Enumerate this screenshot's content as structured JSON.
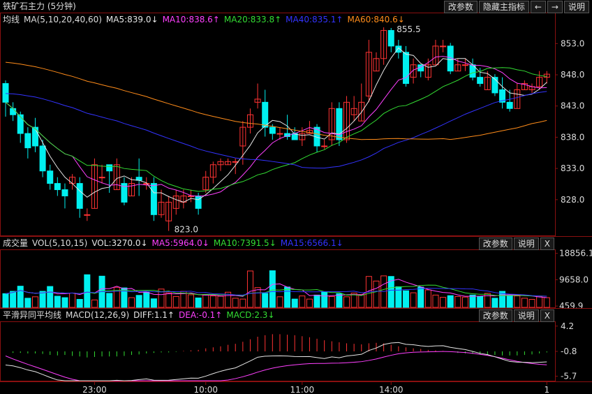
{
  "title": "铁矿石主力 (5分钟)",
  "top_buttons": [
    "改参数",
    "隐藏主指标",
    "←",
    "→",
    "说明"
  ],
  "ma_legend": {
    "label": "均线",
    "params": "MA(5,10,20,40,60)",
    "items": [
      {
        "text": "MA5:839.0↓",
        "color": "#e6e6e6"
      },
      {
        "text": "MA10:838.6↑",
        "color": "#ff40ff"
      },
      {
        "text": "MA20:833.8↑",
        "color": "#33dd33"
      },
      {
        "text": "MA40:835.1↑",
        "color": "#3333ff"
      },
      {
        "text": "MA60:840.6↓",
        "color": "#ff8c1a"
      }
    ]
  },
  "vol_legend": {
    "label": "成交量",
    "params": "VOL(5,10,15)",
    "items": [
      {
        "text": "VOL:3270.0↓",
        "color": "#e6e6e6"
      },
      {
        "text": "MA5:5964.0↓",
        "color": "#ff40ff"
      },
      {
        "text": "MA10:7391.5↓",
        "color": "#33dd33"
      },
      {
        "text": "MA15:6566.1↓",
        "color": "#3333ff"
      }
    ],
    "buttons": [
      "改参数",
      "说明",
      "X"
    ]
  },
  "macd_legend": {
    "label": "平滑异同平均线",
    "params": "MACD(12,26,9)",
    "items": [
      {
        "text": "DIFF:1.1↑",
        "color": "#e6e6e6"
      },
      {
        "text": "DEA:-0.1↑",
        "color": "#ff40ff"
      },
      {
        "text": "MACD:2.3↓",
        "color": "#33dd33"
      }
    ],
    "buttons": [
      "改参数",
      "说明",
      "X"
    ]
  },
  "colors": {
    "up": "#ff3333",
    "down": "#00f0f0",
    "axis": "#8a1010",
    "text": "#dddddd",
    "bg": "#000000"
  },
  "chart_data": [
    {
      "type": "candlestick",
      "title": "铁矿石主力 (5分钟)",
      "ylim": [
        822.5,
        855.5
      ],
      "yticks": [
        828.0,
        833.0,
        838.0,
        843.0,
        848.0,
        853.0
      ],
      "high_label": "855.5",
      "low_label": "823.0",
      "candles": [
        [
          846.6,
          843.6,
          847.1,
          841.3
        ],
        [
          842.6,
          841.6,
          843.6,
          840.6
        ],
        [
          841.6,
          838.6,
          842.1,
          837.1
        ],
        [
          838.6,
          836.3,
          839.6,
          834.6
        ],
        [
          839.6,
          836.6,
          841.1,
          835.6
        ],
        [
          836.6,
          832.6,
          837.6,
          831.6
        ],
        [
          832.6,
          830.6,
          833.6,
          829.6
        ],
        [
          830.6,
          829.6,
          831.6,
          828.6
        ],
        [
          829.6,
          828.6,
          830.6,
          826.6
        ],
        [
          830.6,
          831.6,
          832.1,
          829.6
        ],
        [
          830.6,
          826.6,
          831.6,
          825.1
        ],
        [
          825.6,
          825.6,
          826.6,
          824.6
        ],
        [
          826.6,
          833.6,
          834.6,
          826.6
        ],
        [
          831.6,
          831.6,
          833.6,
          830.6
        ],
        [
          833.6,
          832.6,
          833.6,
          829.1
        ],
        [
          829.6,
          833.6,
          834.6,
          829.6
        ],
        [
          830.6,
          827.6,
          831.6,
          827.1
        ],
        [
          828.6,
          830.6,
          831.6,
          828.6
        ],
        [
          831.6,
          831.1,
          834.6,
          828.6
        ],
        [
          830.6,
          830.6,
          831.6,
          829.6
        ],
        [
          830.6,
          825.6,
          831.6,
          824.6
        ],
        [
          825.6,
          827.6,
          829.6,
          825.1
        ],
        [
          824.6,
          827.6,
          828.6,
          823.0
        ],
        [
          826.6,
          828.6,
          829.6,
          825.6
        ],
        [
          827.6,
          828.6,
          829.6,
          826.6
        ],
        [
          828.6,
          828.6,
          829.6,
          827.6
        ],
        [
          828.6,
          826.6,
          829.1,
          825.6
        ],
        [
          829.6,
          831.6,
          832.6,
          829.1
        ],
        [
          831.6,
          833.6,
          834.1,
          830.6
        ],
        [
          833.6,
          834.1,
          834.6,
          832.6
        ],
        [
          833.6,
          834.1,
          834.6,
          833.6
        ],
        [
          834.1,
          834.1,
          834.6,
          832.1
        ],
        [
          836.6,
          839.6,
          840.6,
          833.6
        ],
        [
          839.6,
          841.6,
          842.6,
          838.6
        ],
        [
          843.6,
          844.1,
          846.6,
          842.6
        ],
        [
          843.6,
          839.6,
          845.6,
          838.1
        ],
        [
          839.6,
          838.6,
          840.1,
          837.6
        ],
        [
          838.6,
          838.6,
          839.6,
          837.6
        ],
        [
          838.6,
          838.1,
          841.6,
          837.6
        ],
        [
          838.6,
          837.6,
          839.6,
          837.6
        ],
        [
          837.6,
          838.6,
          839.6,
          836.6
        ],
        [
          838.6,
          839.1,
          840.6,
          838.6
        ],
        [
          839.6,
          836.6,
          840.1,
          835.6
        ],
        [
          836.6,
          836.6,
          837.6,
          836.1
        ],
        [
          837.6,
          842.6,
          843.6,
          836.6
        ],
        [
          842.6,
          837.6,
          843.6,
          836.6
        ],
        [
          837.6,
          843.6,
          844.6,
          837.1
        ],
        [
          841.6,
          842.6,
          844.6,
          840.6
        ],
        [
          840.6,
          843.6,
          846.6,
          840.6
        ],
        [
          844.6,
          851.6,
          853.6,
          843.6
        ],
        [
          848.6,
          850.6,
          851.6,
          848.6
        ],
        [
          850.6,
          855.1,
          855.6,
          849.6
        ],
        [
          855.1,
          852.6,
          855.5,
          851.6
        ],
        [
          852.6,
          851.6,
          853.6,
          850.6
        ],
        [
          851.6,
          846.6,
          852.6,
          846.1
        ],
        [
          847.6,
          849.6,
          850.6,
          846.6
        ],
        [
          849.6,
          848.6,
          849.6,
          847.6
        ],
        [
          847.6,
          849.6,
          850.6,
          847.1
        ],
        [
          849.6,
          852.6,
          853.6,
          849.6
        ],
        [
          852.6,
          852.6,
          853.6,
          851.6
        ],
        [
          852.6,
          848.6,
          853.1,
          848.1
        ],
        [
          848.6,
          849.6,
          850.6,
          848.6
        ],
        [
          849.6,
          849.6,
          850.6,
          848.6
        ],
        [
          849.6,
          847.6,
          850.6,
          847.1
        ],
        [
          847.6,
          846.6,
          849.1,
          846.1
        ],
        [
          845.6,
          847.6,
          848.6,
          845.6
        ],
        [
          847.6,
          845.1,
          848.1,
          844.6
        ],
        [
          845.6,
          843.6,
          847.6,
          842.6
        ],
        [
          843.6,
          842.6,
          845.6,
          842.1
        ],
        [
          842.6,
          845.6,
          846.6,
          842.6
        ],
        [
          845.6,
          846.6,
          847.1,
          845.6
        ],
        [
          845.6,
          846.1,
          846.6,
          845.1
        ],
        [
          846.1,
          847.6,
          848.6,
          845.6
        ],
        [
          847.6,
          848.1,
          848.6,
          846.6
        ]
      ],
      "x_ticks": [
        {
          "index": 12,
          "label": "23:00"
        },
        {
          "index": 27,
          "label": "10:00"
        },
        {
          "index": 40,
          "label": "11:00"
        },
        {
          "index": 52,
          "label": "14:00"
        },
        {
          "index": 73,
          "label": "1"
        }
      ]
    },
    {
      "type": "bar",
      "title": "VOL(5,10,15)",
      "ylim": [
        0,
        20000
      ],
      "yticks": [
        459.9,
        9658.0,
        18856.1
      ],
      "values": [
        4800,
        5600,
        7400,
        3200,
        3700,
        5600,
        7300,
        3900,
        3400,
        5000,
        2800,
        11400,
        2600,
        10900,
        4900,
        7000,
        6800,
        3400,
        4200,
        5300,
        3000,
        6400,
        5100,
        3800,
        5600,
        4400,
        3300,
        4300,
        4000,
        3900,
        5300,
        3200,
        2900,
        12700,
        6900,
        4900,
        12800,
        3700,
        7100,
        2900,
        4000,
        2900,
        4300,
        5400,
        3800,
        4800,
        3700,
        5000,
        4500,
        10800,
        9200,
        11000,
        10800,
        7200,
        5800,
        5100,
        7100,
        6100,
        4300,
        3500,
        4100,
        3800,
        3600,
        4300,
        3900,
        4900,
        3200,
        5600,
        4400,
        4000,
        3200,
        2800,
        3700,
        3400
      ],
      "directions": [
        "dn",
        "dn",
        "dn",
        "dn",
        "up",
        "dn",
        "dn",
        "dn",
        "dn",
        "up",
        "dn",
        "dn",
        "up",
        "dn",
        "dn",
        "up",
        "dn",
        "up",
        "dn",
        "dn",
        "dn",
        "up",
        "up",
        "up",
        "up",
        "up",
        "dn",
        "up",
        "up",
        "up",
        "up",
        "up",
        "up",
        "up",
        "up",
        "dn",
        "dn",
        "up",
        "dn",
        "dn",
        "up",
        "up",
        "dn",
        "dn",
        "up",
        "dn",
        "up",
        "up",
        "up",
        "up",
        "up",
        "up",
        "dn",
        "dn",
        "dn",
        "up",
        "dn",
        "up",
        "up",
        "up",
        "dn",
        "up",
        "up",
        "dn",
        "dn",
        "up",
        "dn",
        "dn",
        "dn",
        "up",
        "up",
        "up",
        "up",
        "up"
      ]
    },
    {
      "type": "bar",
      "title": "MACD(12,26,9)",
      "ylim": [
        -6.6,
        5.0
      ],
      "yticks": [
        4.2,
        -0.8,
        -5.7
      ],
      "macd_values": [
        0,
        -0.3,
        -0.3,
        -0.4,
        -0.4,
        -0.5,
        -0.7,
        -0.8,
        -0.7,
        -0.9,
        -1.0,
        -1.2,
        -1.1,
        -1.0,
        -1.0,
        -1.0,
        -0.9,
        -0.7,
        -0.6,
        -0.4,
        -0.3,
        -0.2,
        -0.2,
        -0.1,
        0.1,
        0.2,
        0.3,
        0.6,
        0.8,
        1.0,
        1.3,
        1.5,
        1.9,
        2.4,
        2.9,
        3.2,
        3.4,
        3.4,
        3.3,
        3.2,
        3.0,
        2.8,
        2.5,
        2.2,
        2.0,
        1.8,
        1.6,
        1.5,
        1.4,
        1.6,
        1.7,
        1.6,
        1.3,
        1.0,
        0.8,
        0.6,
        0.5,
        0.3,
        0.2,
        0.1,
        -0.1,
        -0.3,
        -0.4,
        -0.5,
        -0.6,
        -0.7,
        -0.7,
        -0.8,
        -0.8,
        -0.8,
        -0.7,
        -0.6,
        -0.4,
        -0.2
      ]
    }
  ]
}
